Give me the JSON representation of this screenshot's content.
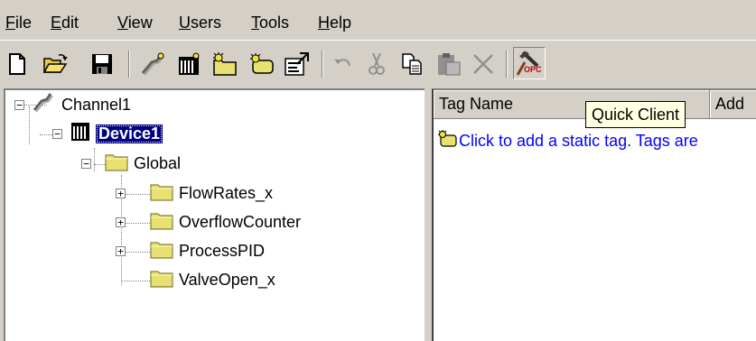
{
  "menu": {
    "items": [
      {
        "key": "file",
        "underline": "F",
        "rest": "ile"
      },
      {
        "key": "edit",
        "underline": "E",
        "rest": "dit"
      },
      {
        "key": "view",
        "underline": "V",
        "rest": "iew"
      },
      {
        "key": "users",
        "underline": "U",
        "rest": "sers"
      },
      {
        "key": "tools",
        "underline": "T",
        "rest": "ools"
      },
      {
        "key": "help",
        "underline": "H",
        "rest": "elp"
      }
    ]
  },
  "toolbar": {
    "buttons": [
      {
        "name": "new-icon"
      },
      {
        "name": "open-folder-icon"
      },
      {
        "name": "save-icon"
      },
      {
        "name": "new-channel-icon"
      },
      {
        "name": "new-device-icon"
      },
      {
        "name": "new-tag-group-icon"
      },
      {
        "name": "new-tag-icon"
      },
      {
        "name": "properties-icon"
      },
      {
        "name": "undo-icon"
      },
      {
        "name": "cut-icon"
      },
      {
        "name": "copy-icon"
      },
      {
        "name": "paste-icon"
      },
      {
        "name": "delete-icon"
      },
      {
        "name": "quick-client-icon"
      }
    ],
    "quick_client_badge": "OPC"
  },
  "tree": {
    "channel": "Channel1",
    "device": "Device1",
    "group": "Global",
    "children": [
      "FlowRates_x",
      "OverflowCounter",
      "ProcessPID",
      "ValveOpen_x"
    ]
  },
  "tags_view": {
    "columns": [
      "Tag Name",
      "Add"
    ],
    "hint": "Click to add a static tag.  Tags are"
  },
  "tooltip": {
    "text": "Quick Client"
  },
  "colors": {
    "face": "#d4d0c8",
    "selection": "#000080",
    "link": "#0000ff",
    "tooltip_bg": "#ffffe1",
    "folder": "#e8e070"
  }
}
